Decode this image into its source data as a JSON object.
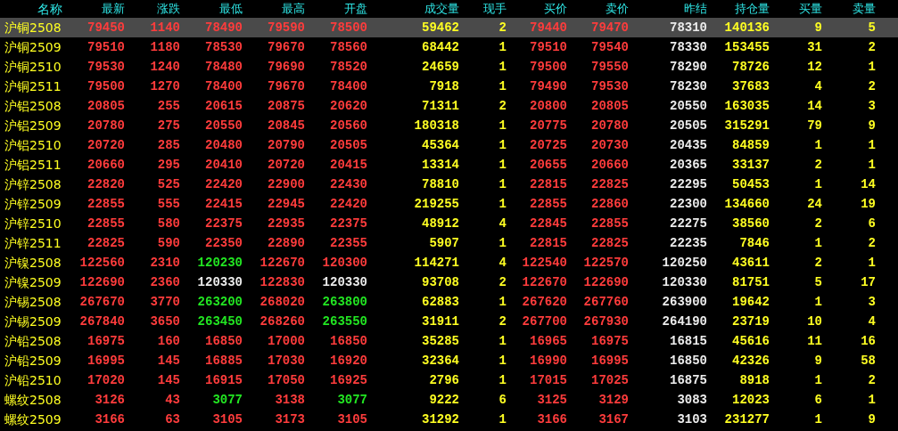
{
  "columns": [
    "名称",
    "最新",
    "涨跌",
    "最低",
    "最高",
    "开盘",
    "成交量",
    "现手",
    "买价",
    "卖价",
    "昨结",
    "持仓量",
    "买量",
    "卖量"
  ],
  "rows": [
    {
      "name": "沪铜2508",
      "last": "79450",
      "change": "1140",
      "low": {
        "text": "78490"
      },
      "high": "79590",
      "open": {
        "text": "78500"
      },
      "volume": "59462",
      "hand": "2",
      "bid": "79440",
      "ask": "79470",
      "settle": "78310",
      "oi": "140136",
      "bid_qty": "9",
      "ask_qty": "5",
      "selected": true
    },
    {
      "name": "沪铜2509",
      "last": "79510",
      "change": "1180",
      "low": {
        "text": "78530"
      },
      "high": "79670",
      "open": {
        "text": "78560"
      },
      "volume": "68442",
      "hand": "1",
      "bid": "79510",
      "ask": "79540",
      "settle": "78330",
      "oi": "153455",
      "bid_qty": "31",
      "ask_qty": "2",
      "selected": false
    },
    {
      "name": "沪铜2510",
      "last": "79530",
      "change": "1240",
      "low": {
        "text": "78480"
      },
      "high": "79690",
      "open": {
        "text": "78520"
      },
      "volume": "24659",
      "hand": "1",
      "bid": "79500",
      "ask": "79550",
      "settle": "78290",
      "oi": "78726",
      "bid_qty": "12",
      "ask_qty": "1",
      "selected": false
    },
    {
      "name": "沪铜2511",
      "last": "79500",
      "change": "1270",
      "low": {
        "text": "78400"
      },
      "high": "79670",
      "open": {
        "text": "78400"
      },
      "volume": "7918",
      "hand": "1",
      "bid": "79490",
      "ask": "79530",
      "settle": "78230",
      "oi": "37683",
      "bid_qty": "4",
      "ask_qty": "2",
      "selected": false
    },
    {
      "name": "沪铝2508",
      "last": "20805",
      "change": "255",
      "low": {
        "text": "20615"
      },
      "high": "20875",
      "open": {
        "text": "20620"
      },
      "volume": "71311",
      "hand": "2",
      "bid": "20800",
      "ask": "20805",
      "settle": "20550",
      "oi": "163035",
      "bid_qty": "14",
      "ask_qty": "3",
      "selected": false
    },
    {
      "name": "沪铝2509",
      "last": "20780",
      "change": "275",
      "low": {
        "text": "20550"
      },
      "high": "20845",
      "open": {
        "text": "20560"
      },
      "volume": "180318",
      "hand": "1",
      "bid": "20775",
      "ask": "20780",
      "settle": "20505",
      "oi": "315291",
      "bid_qty": "79",
      "ask_qty": "9",
      "selected": false
    },
    {
      "name": "沪铝2510",
      "last": "20720",
      "change": "285",
      "low": {
        "text": "20480"
      },
      "high": "20790",
      "open": {
        "text": "20505"
      },
      "volume": "45364",
      "hand": "1",
      "bid": "20725",
      "ask": "20730",
      "settle": "20435",
      "oi": "84859",
      "bid_qty": "1",
      "ask_qty": "1",
      "selected": false
    },
    {
      "name": "沪铝2511",
      "last": "20660",
      "change": "295",
      "low": {
        "text": "20410"
      },
      "high": "20720",
      "open": {
        "text": "20415"
      },
      "volume": "13314",
      "hand": "1",
      "bid": "20655",
      "ask": "20660",
      "settle": "20365",
      "oi": "33137",
      "bid_qty": "2",
      "ask_qty": "1",
      "selected": false
    },
    {
      "name": "沪锌2508",
      "last": "22820",
      "change": "525",
      "low": {
        "text": "22420"
      },
      "high": "22900",
      "open": {
        "text": "22430"
      },
      "volume": "78810",
      "hand": "1",
      "bid": "22815",
      "ask": "22825",
      "settle": "22295",
      "oi": "50453",
      "bid_qty": "1",
      "ask_qty": "14",
      "selected": false
    },
    {
      "name": "沪锌2509",
      "last": "22855",
      "change": "555",
      "low": {
        "text": "22415"
      },
      "high": "22945",
      "open": {
        "text": "22420"
      },
      "volume": "219255",
      "hand": "1",
      "bid": "22855",
      "ask": "22860",
      "settle": "22300",
      "oi": "134660",
      "bid_qty": "24",
      "ask_qty": "19",
      "selected": false
    },
    {
      "name": "沪锌2510",
      "last": "22855",
      "change": "580",
      "low": {
        "text": "22375"
      },
      "high": "22935",
      "open": {
        "text": "22375"
      },
      "volume": "48912",
      "hand": "4",
      "bid": "22845",
      "ask": "22855",
      "settle": "22275",
      "oi": "38560",
      "bid_qty": "2",
      "ask_qty": "6",
      "selected": false
    },
    {
      "name": "沪锌2511",
      "last": "22825",
      "change": "590",
      "low": {
        "text": "22350"
      },
      "high": "22890",
      "open": {
        "text": "22355"
      },
      "volume": "5907",
      "hand": "1",
      "bid": "22815",
      "ask": "22825",
      "settle": "22235",
      "oi": "7846",
      "bid_qty": "1",
      "ask_qty": "2",
      "selected": false
    },
    {
      "name": "沪镍2508",
      "last": "122560",
      "change": "2310",
      "low": {
        "text": "120230",
        "color": "#22e622"
      },
      "high": "122670",
      "open": {
        "text": "120300"
      },
      "volume": "114271",
      "hand": "4",
      "bid": "122540",
      "ask": "122570",
      "settle": "120250",
      "oi": "43611",
      "bid_qty": "2",
      "ask_qty": "1",
      "selected": false
    },
    {
      "name": "沪镍2509",
      "last": "122690",
      "change": "2360",
      "low": {
        "text": "120330",
        "color": "#ececec"
      },
      "high": "122830",
      "open": {
        "text": "120330",
        "color": "#ececec"
      },
      "volume": "93708",
      "hand": "2",
      "bid": "122670",
      "ask": "122690",
      "settle": "120330",
      "oi": "81751",
      "bid_qty": "5",
      "ask_qty": "17",
      "selected": false
    },
    {
      "name": "沪锡2508",
      "last": "267670",
      "change": "3770",
      "low": {
        "text": "263200",
        "color": "#22e622"
      },
      "high": "268020",
      "open": {
        "text": "263800",
        "color": "#22e622"
      },
      "volume": "62883",
      "hand": "1",
      "bid": "267620",
      "ask": "267760",
      "settle": "263900",
      "oi": "19642",
      "bid_qty": "1",
      "ask_qty": "3",
      "selected": false
    },
    {
      "name": "沪锡2509",
      "last": "267840",
      "change": "3650",
      "low": {
        "text": "263450",
        "color": "#22e622"
      },
      "high": "268260",
      "open": {
        "text": "263550",
        "color": "#22e622"
      },
      "volume": "31911",
      "hand": "2",
      "bid": "267700",
      "ask": "267930",
      "settle": "264190",
      "oi": "23719",
      "bid_qty": "10",
      "ask_qty": "4",
      "selected": false
    },
    {
      "name": "沪铅2508",
      "last": "16975",
      "change": "160",
      "low": {
        "text": "16850"
      },
      "high": "17000",
      "open": {
        "text": "16850"
      },
      "volume": "35285",
      "hand": "1",
      "bid": "16965",
      "ask": "16975",
      "settle": "16815",
      "oi": "45616",
      "bid_qty": "11",
      "ask_qty": "16",
      "selected": false
    },
    {
      "name": "沪铅2509",
      "last": "16995",
      "change": "145",
      "low": {
        "text": "16885"
      },
      "high": "17030",
      "open": {
        "text": "16920"
      },
      "volume": "32364",
      "hand": "1",
      "bid": "16990",
      "ask": "16995",
      "settle": "16850",
      "oi": "42326",
      "bid_qty": "9",
      "ask_qty": "58",
      "selected": false
    },
    {
      "name": "沪铅2510",
      "last": "17020",
      "change": "145",
      "low": {
        "text": "16915"
      },
      "high": "17050",
      "open": {
        "text": "16925"
      },
      "volume": "2796",
      "hand": "1",
      "bid": "17015",
      "ask": "17025",
      "settle": "16875",
      "oi": "8918",
      "bid_qty": "1",
      "ask_qty": "2",
      "selected": false
    },
    {
      "name": "螺纹2508",
      "last": "3126",
      "change": "43",
      "low": {
        "text": "3077",
        "color": "#22e622"
      },
      "high": "3138",
      "open": {
        "text": "3077",
        "color": "#22e622"
      },
      "volume": "9222",
      "hand": "6",
      "bid": "3125",
      "ask": "3129",
      "settle": "3083",
      "oi": "12023",
      "bid_qty": "6",
      "ask_qty": "1",
      "selected": false
    },
    {
      "name": "螺纹2509",
      "last": "3166",
      "change": "63",
      "low": {
        "text": "3105"
      },
      "high": "3173",
      "open": {
        "text": "3105"
      },
      "volume": "31292",
      "hand": "1",
      "bid": "3166",
      "ask": "3167",
      "settle": "3103",
      "oi": "231277",
      "bid_qty": "1",
      "ask_qty": "9",
      "selected": false
    }
  ]
}
